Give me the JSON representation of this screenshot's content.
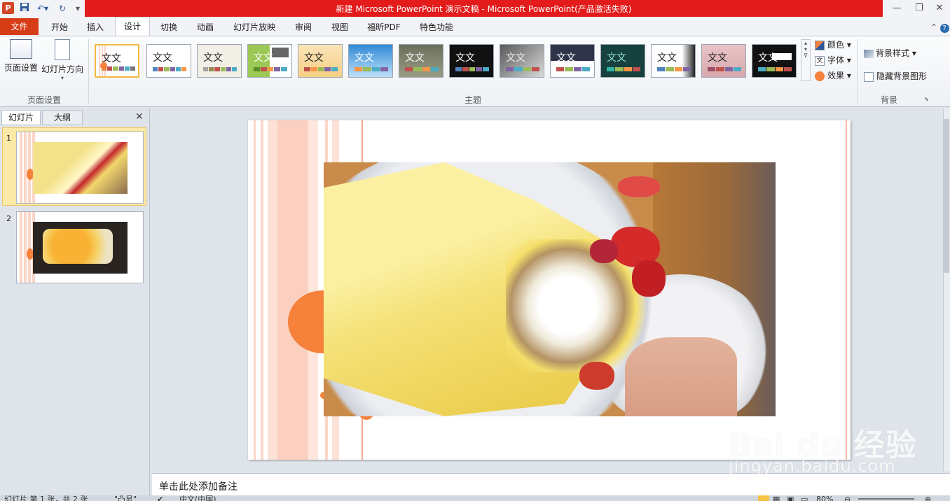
{
  "window": {
    "title": "新建 Microsoft PowerPoint 演示文稿 - Microsoft PowerPoint(产品激活失败)",
    "app_icon": "P",
    "minimize": "—",
    "restore": "❐",
    "close": "✕"
  },
  "tabs": {
    "file": "文件",
    "items": [
      "开始",
      "插入",
      "设计",
      "切换",
      "动画",
      "幻灯片放映",
      "审阅",
      "视图",
      "福昕PDF",
      "特色功能"
    ],
    "active": "设计"
  },
  "ribbon": {
    "page_setup": {
      "page_setup_label": "页面设置",
      "orientation_label": "幻灯片方向",
      "group_label": "页面设置"
    },
    "themes": {
      "group_label": "主题",
      "sample_text": "文文",
      "count": 14
    },
    "theme_options": {
      "colors": "颜色",
      "fonts": "字体",
      "effects": "效果"
    },
    "background": {
      "styles": "背景样式",
      "hide_graphics": "隐藏背景图形",
      "group_label": "背景"
    }
  },
  "left_pane": {
    "tab_slides": "幻灯片",
    "tab_outline": "大纲",
    "slides": [
      {
        "number": "1",
        "selected": true
      },
      {
        "number": "2",
        "selected": false
      }
    ]
  },
  "notes": {
    "placeholder": "单击此处添加备注"
  },
  "status": {
    "slide_info": "幻灯片 第 1 张，共 2 张",
    "theme_name": "\"凸显\"",
    "language": "中文(中国)",
    "zoom": "80%"
  },
  "watermark": {
    "brand": "Bai du 经验",
    "url": "jingyan.baidu.com"
  },
  "colors": {
    "file_tab": "#d63c16",
    "title_bar": "#e31b1b",
    "accent_orange": "#f5813b",
    "stripe_peach": "#fbd6c8"
  }
}
